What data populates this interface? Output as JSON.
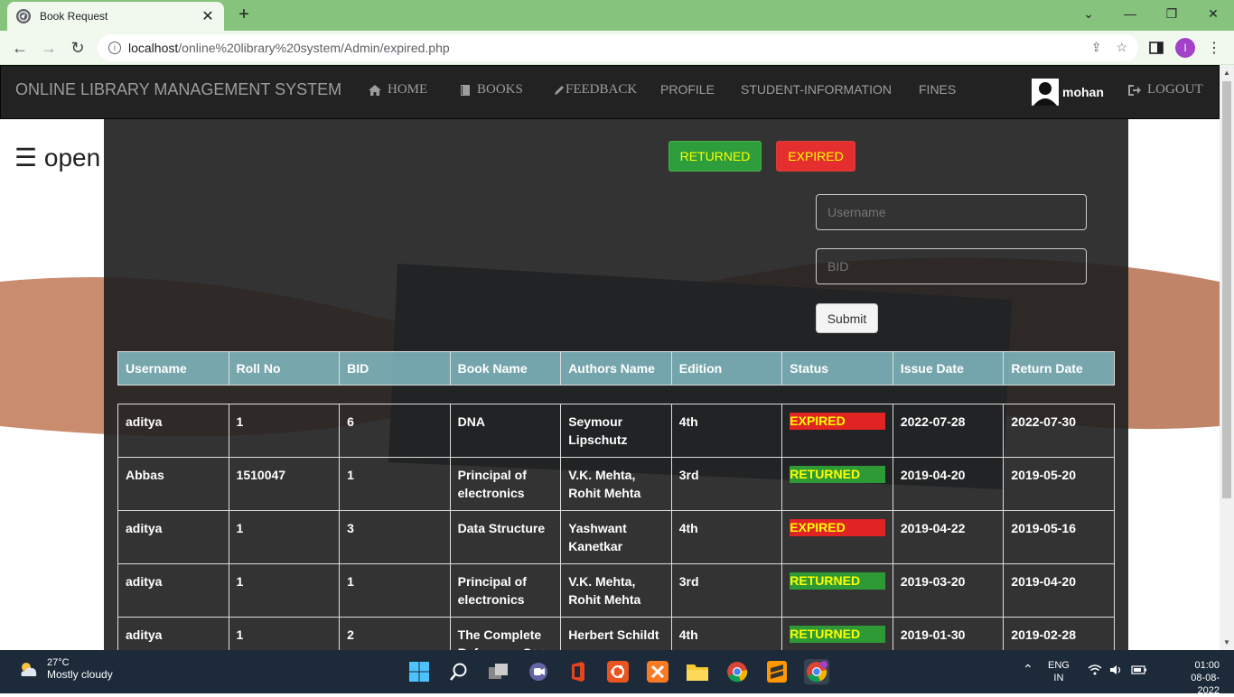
{
  "browser": {
    "tab_title": "Book Request",
    "url_host": "localhost",
    "url_path": "/online%20library%20system/Admin/expired.php",
    "profile_initial": "I"
  },
  "navbar": {
    "brand": "ONLINE LIBRARY MANAGEMENT SYSTEM",
    "items": [
      {
        "label": "HOME",
        "icon": "home-icon"
      },
      {
        "label": "BOOKS",
        "icon": "book-icon"
      },
      {
        "label": "FEEDBACK",
        "icon": "pencil-icon"
      },
      {
        "label": "PROFILE"
      },
      {
        "label": "STUDENT-INFORMATION"
      },
      {
        "label": "FINES"
      }
    ],
    "username": "mohan",
    "logout": "LOGOUT"
  },
  "sidenav_toggle": "☰ open",
  "filters": {
    "returned": "RETURNED",
    "expired": "EXPIRED"
  },
  "form": {
    "username_placeholder": "Username",
    "bid_placeholder": "BID",
    "submit": "Submit"
  },
  "table": {
    "headers": [
      "Username",
      "Roll No",
      "BID",
      "Book Name",
      "Authors Name",
      "Edition",
      "Status",
      "Issue Date",
      "Return Date"
    ],
    "rows": [
      [
        "aditya",
        "1",
        "6",
        "DNA",
        "Seymour Lipschutz",
        "4th",
        "EXPIRED",
        "2022-07-28",
        "2022-07-30"
      ],
      [
        "Abbas",
        "1510047",
        "1",
        "Principal of electronics",
        "V.K. Mehta, Rohit Mehta",
        "3rd",
        "RETURNED",
        "2019-04-20",
        "2019-05-20"
      ],
      [
        "aditya",
        "1",
        "3",
        "Data Structure",
        "Yashwant Kanetkar",
        "4th",
        "EXPIRED",
        "2019-04-22",
        "2019-05-16"
      ],
      [
        "aditya",
        "1",
        "1",
        "Principal of electronics",
        "V.K. Mehta, Rohit Mehta",
        "3rd",
        "RETURNED",
        "2019-03-20",
        "2019-04-20"
      ],
      [
        "aditya",
        "1",
        "2",
        "The Complete Reference C++",
        "Herbert Schildt",
        "4th",
        "RETURNED",
        "2019-01-30",
        "2019-02-28"
      ]
    ]
  },
  "colors": {
    "expired": "#e02424",
    "returned": "#2e9a35",
    "status_text": "#ffff00",
    "header_bg": "#87c2cb",
    "navbar_bg": "#222222"
  },
  "taskbar": {
    "temp": "27°C",
    "weather": "Mostly cloudy",
    "lang1": "ENG",
    "lang2": "IN",
    "time": "01:00",
    "date": "08-08-2022"
  }
}
